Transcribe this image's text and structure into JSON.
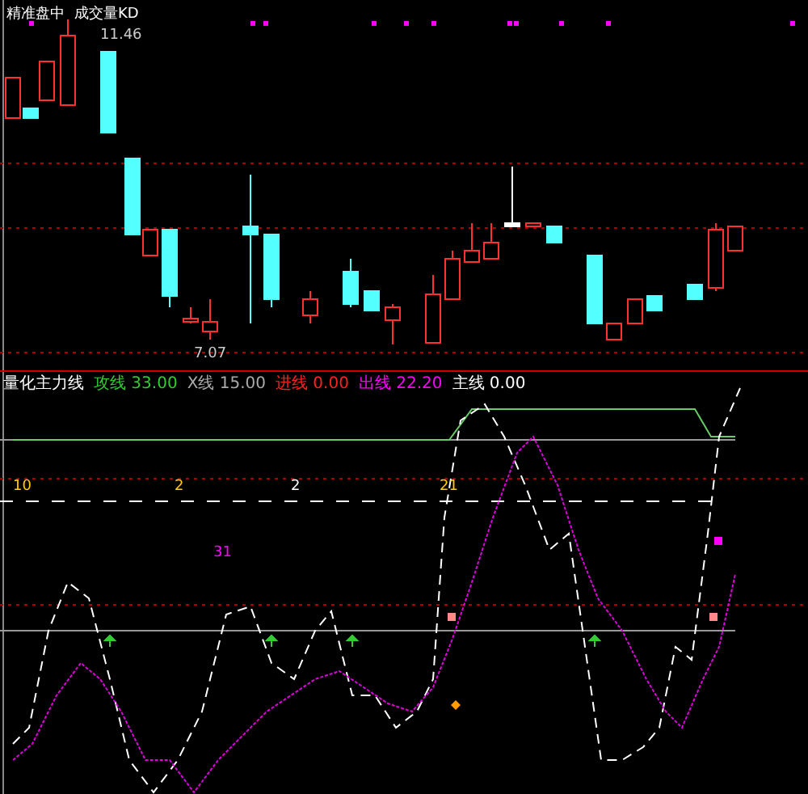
{
  "price_panel": {
    "title": "精准盘中",
    "indicator_name": "成交量KD",
    "high_label": "11.46",
    "low_label": "7.07"
  },
  "indicator_panel": {
    "title": "量化主力线",
    "legend": [
      {
        "label": "攻线",
        "value": "33.00",
        "color": "#33cc33"
      },
      {
        "label": "X线",
        "value": "15.00",
        "color": "#aaaaaa"
      },
      {
        "label": "进线",
        "value": "0.00",
        "color": "#ff2020"
      },
      {
        "label": "出线",
        "value": "22.20",
        "color": "#ff00ff"
      },
      {
        "label": "主线",
        "value": "0.00",
        "color": "#ffffff"
      }
    ],
    "markers": [
      {
        "text": "10",
        "color": "#ffcc00"
      },
      {
        "text": "2",
        "color": "#ffcc00"
      },
      {
        "text": "2",
        "color": "#ffffff"
      },
      {
        "text": "21",
        "color": "#ffcc00"
      },
      {
        "text": "31",
        "color": "#ff00ff"
      }
    ]
  }
}
